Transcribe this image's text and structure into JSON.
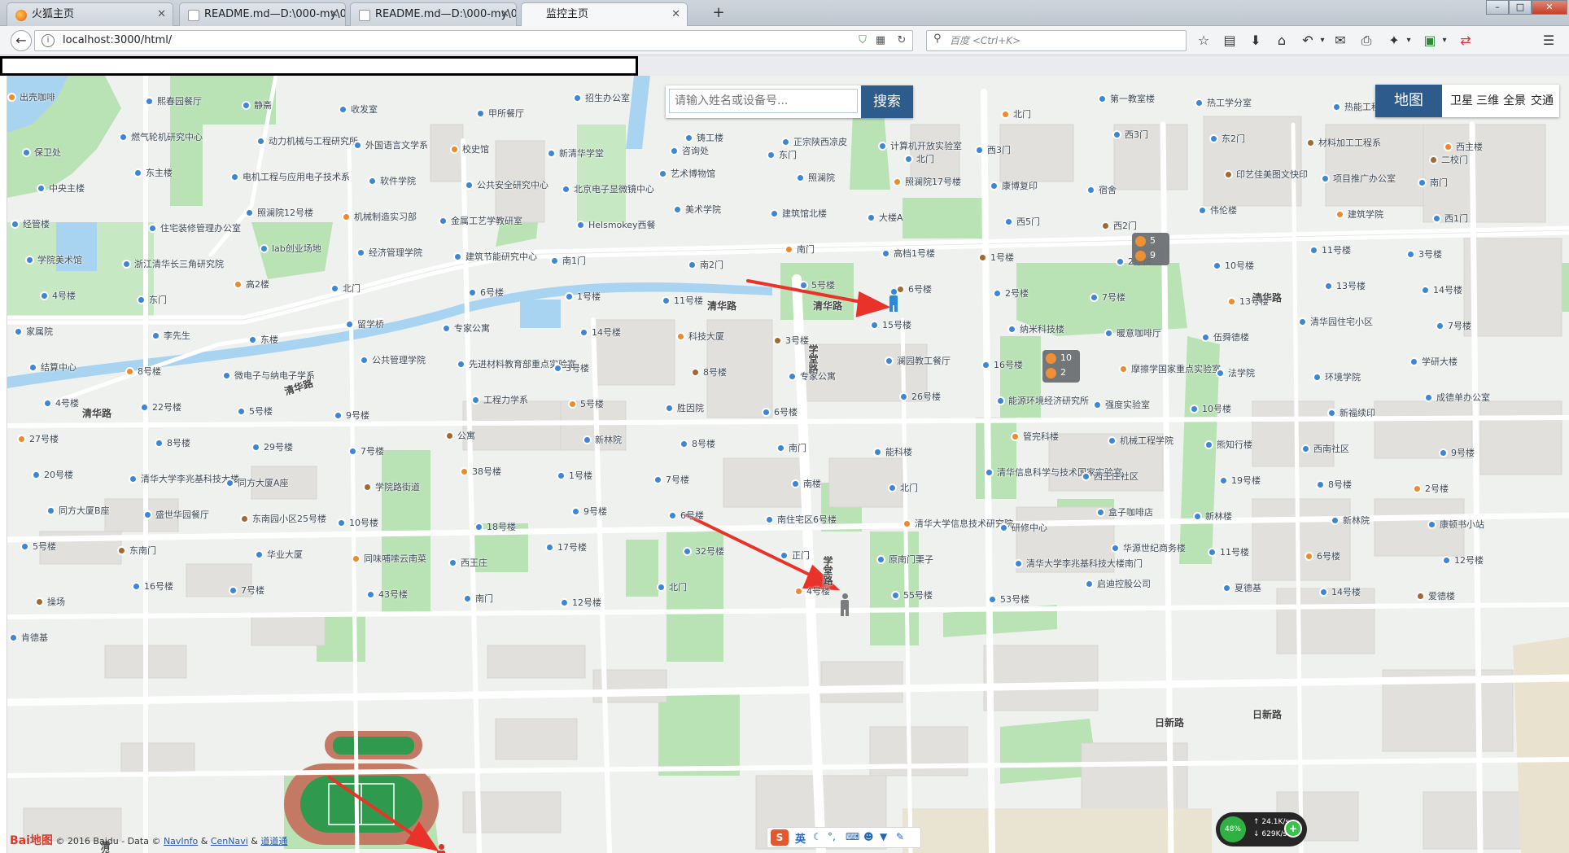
{
  "tabs": [
    {
      "label": "火狐主页",
      "active": false
    },
    {
      "label": "README.md—D:\\000-my\\0...",
      "active": false
    },
    {
      "label": "README.md—D:\\000-my\\0...",
      "active": false
    },
    {
      "label": "监控主页",
      "active": true
    }
  ],
  "nav": {
    "url": "localhost:3000/html/",
    "search_placeholder": "百度 <Ctrl+K>"
  },
  "map_search": {
    "placeholder": "请输入姓名或设备号...",
    "button_label": "搜索"
  },
  "map_types": {
    "active": "地图",
    "options": [
      "卫星",
      "三维",
      "全景",
      "交通"
    ]
  },
  "clusters": [
    {
      "top": "5",
      "bottom": "9"
    },
    {
      "top": "10",
      "bottom": "2"
    }
  ],
  "map_labels": {
    "roads": [
      "清华路",
      "清华路",
      "清华路",
      "清华路",
      "清华路",
      "学堂路",
      "学堂路",
      "日新路",
      "日新路",
      "清华南路"
    ],
    "places": [
      "出壳咖啡",
      "熙春园餐厅",
      "静斋",
      "收发室",
      "甲所餐厅",
      "招生办公室",
      "咨询处",
      "东门",
      "北门",
      "北门",
      "第一教室楼",
      "热工学分室",
      "热能工程系",
      "二校门",
      "保卫处",
      "燃气轮机研究中心",
      "动力机械与工程研究所",
      "外国语言文学系",
      "校史馆",
      "新清华学堂",
      "铸工楼",
      "正宗陕西凉皮",
      "计算机开放实验室",
      "西3门",
      "西3门",
      "东2门",
      "材料加工工程系",
      "西主楼",
      "中央主楼",
      "东主楼",
      "电机工程与应用电子技术系",
      "软件学院",
      "公共安全研究中心",
      "北京电子显微镜中心",
      "艺术博物馆",
      "照澜院",
      "照澜院17号楼",
      "康博复印",
      "宿舍",
      "印艺佳美图文快印",
      "项目推广办公室",
      "南门",
      "经管楼",
      "住宅装修管理办公室",
      "照澜院12号楼",
      "机械制造实习部",
      "金属工艺学教研室",
      "Helsmokey西餐",
      "美术学院",
      "建筑馆北楼",
      "大楼A",
      "西5门",
      "西2门",
      "伟伦楼",
      "建筑学院",
      "西1门",
      "学院美术馆",
      "浙江清华长三角研究院",
      "lab创业场地",
      "经济管理学院",
      "建筑节能研究中心",
      "南1门",
      "南2门",
      "南门",
      "高档1号楼",
      "1号楼",
      "2号楼",
      "10号楼",
      "11号楼",
      "3号楼",
      "4号楼",
      "东门",
      "高2楼",
      "北门",
      "6号楼",
      "1号楼",
      "11号楼",
      "5号楼",
      "6号楼",
      "2号楼",
      "7号楼",
      "13号楼",
      "13号楼",
      "14号楼",
      "家属院",
      "李先生",
      "东楼",
      "留学桥",
      "专家公寓",
      "14号楼",
      "科技大厦",
      "3号楼",
      "15号楼",
      "纳米科技楼",
      "暖意咖啡厅",
      "伍舜德楼",
      "清华园住宅小区",
      "7号楼",
      "结算中心",
      "8号楼",
      "微电子与纳电子学系",
      "公共管理学院",
      "先进材料教育部重点实验室",
      "3号楼",
      "8号楼",
      "专家公寓",
      "澜园教工餐厅",
      "16号楼",
      "摩擦学国家重点实验室",
      "法学院",
      "环境学院",
      "学研大楼",
      "4号楼",
      "22号楼",
      "5号楼",
      "9号楼",
      "工程力学系",
      "5号楼",
      "胜因院",
      "6号楼",
      "26号楼",
      "能源环境经济研究所",
      "强度实验室",
      "10号楼",
      "新福续印",
      "成德单办公室",
      "27号楼",
      "8号楼",
      "29号楼",
      "7号楼",
      "公寓",
      "新林院",
      "8号楼",
      "南门",
      "能科楼",
      "管完科楼",
      "机械工程学院",
      "熊知行楼",
      "西南社区",
      "9号楼",
      "20号楼",
      "清华大学李兆基科技大楼",
      "同方大厦A座",
      "学院路街道",
      "38号楼",
      "1号楼",
      "7号楼",
      "南楼",
      "北门",
      "清华信息科学与技术国家实验室",
      "西王庄社区",
      "19号楼",
      "8号楼",
      "2号楼",
      "同方大厦B座",
      "盛世华园餐厅",
      "东南园小区25号楼",
      "10号楼",
      "18号楼",
      "9号楼",
      "6号楼",
      "南住宅区6号楼",
      "清华大学信息技术研究院",
      "研修中心",
      "盒子咖啡店",
      "新林楼",
      "新林院",
      "康顿书小站",
      "5号楼",
      "东南门",
      "华业大厦",
      "同味哺嗦云南菜",
      "西王庄",
      "17号楼",
      "32号楼",
      "正门",
      "原南门栗子",
      "清华大学李兆基科技大楼南门",
      "华源世纪商务楼",
      "11号楼",
      "6号楼",
      "12号楼",
      "操场",
      "16号楼",
      "7号楼",
      "43号楼",
      "南门",
      "12号楼",
      "北门",
      "4号楼",
      "55号楼",
      "53号楼",
      "启迪控股公司",
      "夏德基",
      "14号楼",
      "爱德楼",
      "肯德基"
    ]
  },
  "copyright": {
    "logo": "Bai地图",
    "text": "© 2016 Baidu - Data ©",
    "links": [
      "NavInfo",
      "CenNavi",
      "道道通"
    ],
    "sep": "&"
  },
  "ime": {
    "label": "英"
  },
  "net": {
    "percent": "48%",
    "up": "24.1K/s",
    "down": "629K/s"
  },
  "colors": {
    "accent": "#2d5b8c",
    "green": "#b9e3b5",
    "water": "#a8d4f2",
    "building": "#e0dfdc",
    "person_blue": "#2a8ad9",
    "person_gray": "#7a7c7d",
    "person_red": "#e0312b",
    "arrow_red": "#e8322a"
  }
}
